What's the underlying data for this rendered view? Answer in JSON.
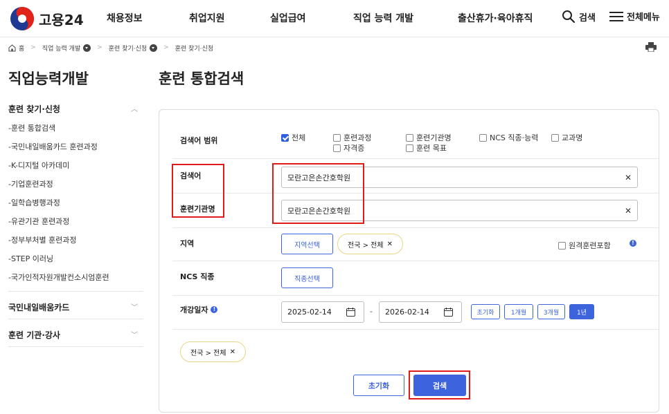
{
  "header": {
    "logo_text": "고용24",
    "nav": [
      "채용정보",
      "취업지원",
      "실업급여",
      "직업 능력 개발",
      "출산휴가·육아휴직"
    ],
    "search_label": "검색",
    "menu_label": "전체메뉴"
  },
  "breadcrumb": {
    "home": "홈",
    "items": [
      "직업 능력 개발",
      "훈련 찾기·신청",
      "훈련 찾기·신청"
    ]
  },
  "sidebar": {
    "title": "직업능력개발",
    "group1": "훈련 찾기·신청",
    "items": [
      "-훈련 통합검색",
      "-국민내일배움카드 훈련과정",
      "-K-디지털 아카데미",
      "-기업훈련과정",
      "-일학습병행과정",
      "-유관기관 훈련과정",
      "-정부부처별 훈련과정",
      "-STEP 이러닝",
      "-국가인적자원개발컨소시엄훈련"
    ],
    "group2": "국민내일배움카드",
    "group3": "훈련 기관·강사"
  },
  "main": {
    "title": "훈련 통합검색",
    "scope_label": "검색어 범위",
    "scope_options": [
      {
        "label": "전체",
        "checked": true
      },
      {
        "label": "훈련과정",
        "checked": false
      },
      {
        "label": "자격증",
        "checked": false
      },
      {
        "label": "훈련기관명",
        "checked": false
      },
      {
        "label": "훈련 목표",
        "checked": false
      },
      {
        "label": "NCS 직종·능력",
        "checked": false
      },
      {
        "label": "교과명",
        "checked": false
      }
    ],
    "keyword_label": "검색어",
    "keyword_value": "모란고은손간호학원",
    "institution_label": "훈련기관명",
    "institution_value": "모란고은손간호학원",
    "region_label": "지역",
    "region_button": "지역선택",
    "region_chip": "전국 > 전체",
    "remote_label": "원격훈련포함",
    "ncs_label": "NCS 직종",
    "ncs_button": "직종선택",
    "date_label": "개강일자",
    "date_from": "2025-02-14",
    "date_sep": "-",
    "date_to": "2026-02-14",
    "period_buttons": [
      "초기화",
      "1개월",
      "3개월",
      "1년"
    ],
    "selected_chip": "전국 > 전체",
    "reset_button": "초기화",
    "search_button": "검색"
  },
  "colors": {
    "accent": "#3d63dd",
    "highlight": "#e01919",
    "chip_border": "#e8d682"
  }
}
